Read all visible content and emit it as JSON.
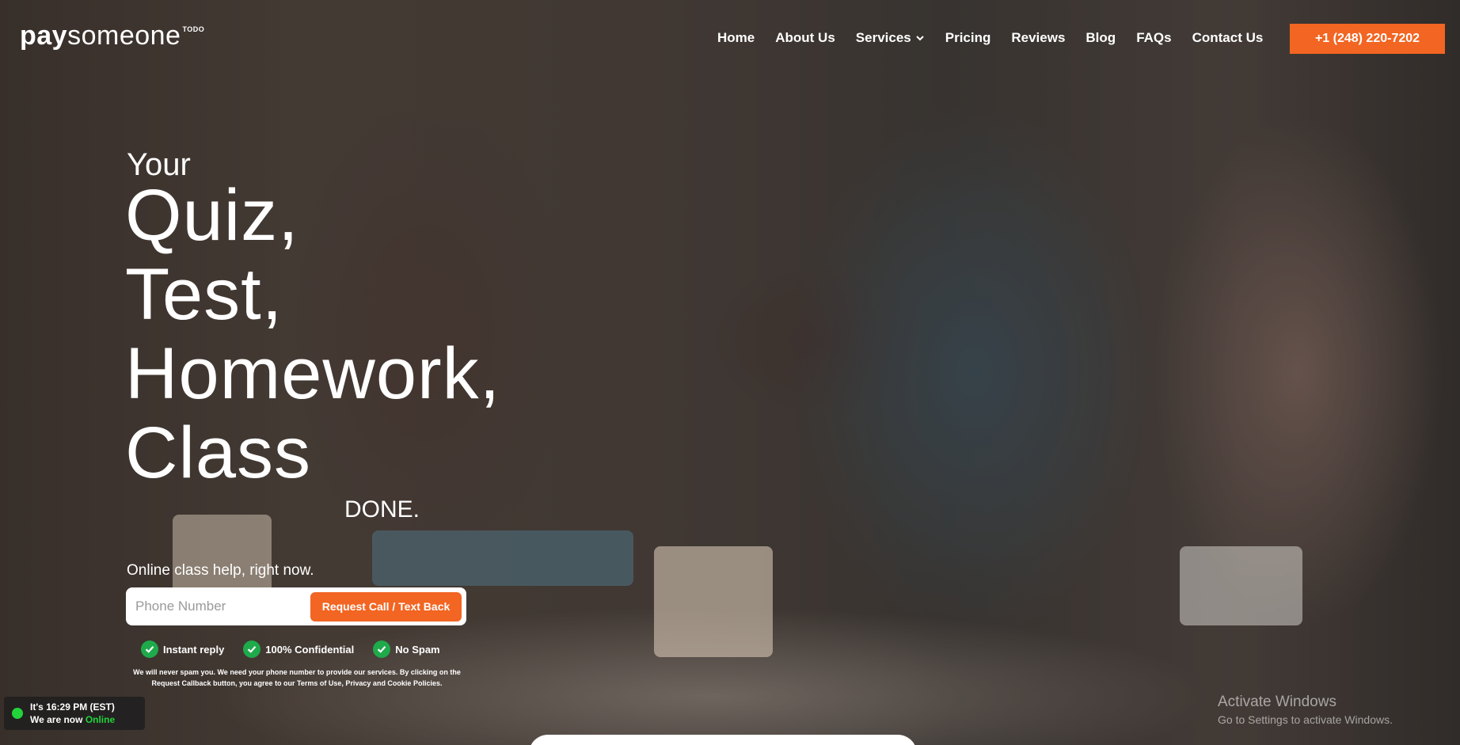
{
  "brand": {
    "logo_bold": "pay",
    "logo_light": "someone",
    "logo_sup": "TODO"
  },
  "nav": {
    "items": [
      "Home",
      "About Us",
      "Services",
      "Pricing",
      "Reviews",
      "Blog",
      "FAQs",
      "Contact Us"
    ],
    "services_has_dropdown": true,
    "phone_button": "+1 (248) 220-7202"
  },
  "hero": {
    "intro": "Your",
    "lines": [
      "Quiz,",
      "Test,",
      "Homework,",
      "Class"
    ],
    "done": "DONE.",
    "subline": "Online class help, right now."
  },
  "form": {
    "phone_placeholder": "Phone Number",
    "phone_value": "",
    "submit_label": "Request Call / Text Back"
  },
  "badges": [
    "Instant reply",
    "100% Confidential",
    "No Spam"
  ],
  "disclaimer": "We will never spam you. We need your phone number to provide our services. By clicking on the Request Callback button, you agree to our Terms of Use, Privacy and Cookie Policies.",
  "status": {
    "time_text": "It's 16:29 PM (EST)",
    "now_prefix": "We are now",
    "now_state": "Online"
  },
  "watermark": {
    "title": "Activate Windows",
    "subtitle": "Go to Settings to activate Windows."
  },
  "colors": {
    "accent": "#f26522",
    "check": "#1faa4b",
    "online": "#22d33a"
  },
  "icons": {
    "services_dropdown": "chevron-down-icon",
    "badge": "check-circle-icon",
    "status": "online-dot-icon"
  }
}
